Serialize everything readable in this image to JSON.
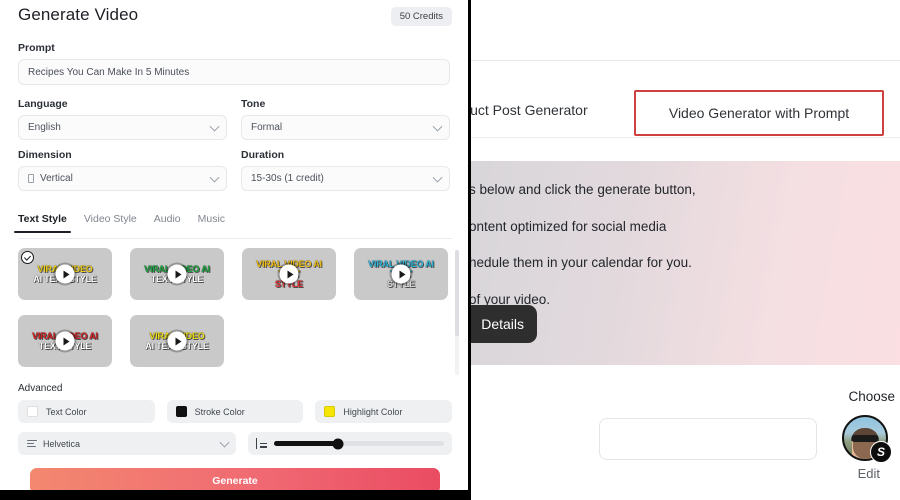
{
  "left": {
    "title": "Generate Video",
    "credits": "50 Credits",
    "prompt": {
      "label": "Prompt",
      "value": "Recipes You Can Make In 5 Minutes"
    },
    "language": {
      "label": "Language",
      "value": "English"
    },
    "tone": {
      "label": "Tone",
      "value": "Formal"
    },
    "dimension": {
      "label": "Dimension",
      "value": "Vertical"
    },
    "duration": {
      "label": "Duration",
      "value": "15-30s (1 credit)"
    },
    "tabs": [
      {
        "label": "Text Style",
        "active": true
      },
      {
        "label": "Video Style",
        "active": false
      },
      {
        "label": "Audio",
        "active": false
      },
      {
        "label": "Music",
        "active": false
      }
    ],
    "styles": [
      {
        "line1": "VIRAL VIDEO",
        "line2": "AI TEXT STYLE",
        "color1": "#f2d21a",
        "color2": "#ffffff",
        "selected": true
      },
      {
        "line1": "VIRAL VIDEO AI",
        "line2": "TEXT STYLE",
        "color1": "#1faa44",
        "color2": "#ffffff",
        "selected": false
      },
      {
        "line1": "VIRAL VIDEO AI TEXT",
        "line2": "STYLE",
        "color1": "#f2c21a",
        "color2": "#e03636",
        "selected": false
      },
      {
        "line1": "VIRAL VIDEO AI TEXT",
        "line2": "STYLE",
        "color1": "#2fb6d8",
        "color2": "#d8d8d8",
        "selected": false
      },
      {
        "line1": "VIRAL VIDEO AI",
        "line2": "TEXT STYLE",
        "color1": "#d42424",
        "color2": "#ffffff",
        "selected": false
      },
      {
        "line1": "VIRAL VIDEO",
        "line2": "AI TEXT STYLE",
        "color1": "#f2e01a",
        "color2": "#ffffff",
        "selected": false
      }
    ],
    "advanced": {
      "label": "Advanced",
      "text_color": {
        "label": "Text Color",
        "swatch": "#ffffff"
      },
      "stroke_color": {
        "label": "Stroke Color",
        "swatch": "#111111"
      },
      "highlight_color": {
        "label": "Highlight Color",
        "swatch": "#f6e500"
      },
      "font": "Helvetica",
      "line_height_percent": 38
    },
    "generate_label": "Generate"
  },
  "right": {
    "tab_partial": "luct Post Generator",
    "tab_highlighted": "Video Generator with Prompt",
    "hero_lines": [
      "s below and click the generate button,",
      "ontent optimized for social media",
      "hedule them in your calendar for you.",
      "of your video."
    ],
    "details_label": "Details",
    "choose_label": "Choose",
    "edit_label": "Edit",
    "badge_letter": "S"
  }
}
